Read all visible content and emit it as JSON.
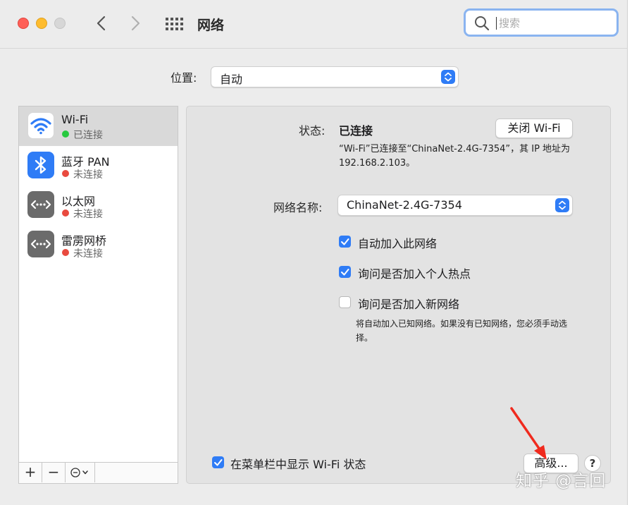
{
  "window": {
    "title": "网络"
  },
  "search": {
    "placeholder": "搜索"
  },
  "location": {
    "label": "位置:",
    "value": "自动"
  },
  "services": [
    {
      "name": "Wi-Fi",
      "status": "已连接",
      "status_color": "#27c93f",
      "icon": "wifi-icon"
    },
    {
      "name": "蓝牙 PAN",
      "status": "未连接",
      "status_color": "#e94a3f",
      "icon": "bluetooth-icon"
    },
    {
      "name": "以太网",
      "status": "未连接",
      "status_color": "#e94a3f",
      "icon": "ethernet-icon"
    },
    {
      "name": "雷雳网桥",
      "status": "未连接",
      "status_color": "#e94a3f",
      "icon": "thunderbolt-bridge-icon"
    }
  ],
  "service_toolbar": {
    "add": "+",
    "remove": "−"
  },
  "detail": {
    "status_label": "状态:",
    "status_value": "已连接",
    "toggle_wifi_label": "关闭 Wi-Fi",
    "status_description": "“Wi-Fi”已连接至“ChinaNet-2.4G-7354”，其 IP 地址为 192.168.2.103。",
    "network_name_label": "网络名称:",
    "network_name_value": "ChinaNet-2.4G-7354",
    "options": [
      {
        "label": "自动加入此网络",
        "checked": true
      },
      {
        "label": "询问是否加入个人热点",
        "checked": true
      },
      {
        "label": "询问是否加入新网络",
        "checked": false
      }
    ],
    "new_network_note": "将自动加入已知网络。如果没有已知网络，您必须手动选择。",
    "show_in_menubar_label": "在菜单栏中显示 Wi-Fi 状态",
    "show_in_menubar_checked": true,
    "advanced_label": "高级...",
    "help_label": "?"
  },
  "watermark": "知乎 @言回",
  "colors": {
    "accent": "#2f7cf6",
    "connected": "#27c93f",
    "disconnected": "#e94a3f"
  }
}
